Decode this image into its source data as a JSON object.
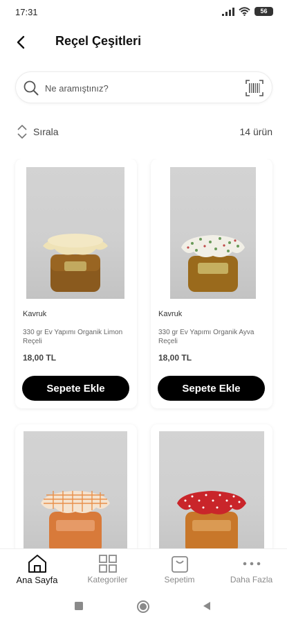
{
  "status": {
    "time": "17:31",
    "battery": "56"
  },
  "header": {
    "title": "Reçel Çeşitleri"
  },
  "search": {
    "placeholder": "Ne aramıştınız?"
  },
  "sortbar": {
    "sort_label": "Sırala",
    "count": "14 ürün"
  },
  "products": [
    {
      "brand": "Kavruk",
      "name": "330 gr Ev Yapımı Organik Limon Reçeli",
      "price": "18,00 TL",
      "button": "Sepete Ekle"
    },
    {
      "brand": "Kavruk",
      "name": "330 gr Ev Yapımı Organik Ayva Reçeli",
      "price": "18,00 TL",
      "button": "Sepete Ekle"
    },
    {
      "brand": "",
      "name": "",
      "price": "",
      "button": ""
    },
    {
      "brand": "",
      "name": "",
      "price": "",
      "button": ""
    }
  ],
  "bottom_nav": [
    {
      "label": "Ana Sayfa",
      "icon": "home-icon",
      "active": true
    },
    {
      "label": "Kategoriler",
      "icon": "grid-icon",
      "active": false
    },
    {
      "label": "Sepetim",
      "icon": "bag-icon",
      "active": false
    },
    {
      "label": "Daha Fazla",
      "icon": "more-icon",
      "active": false
    }
  ],
  "colors": {
    "primary_button": "#000000",
    "background": "#ffffff",
    "card_border": "#eeeeee"
  }
}
